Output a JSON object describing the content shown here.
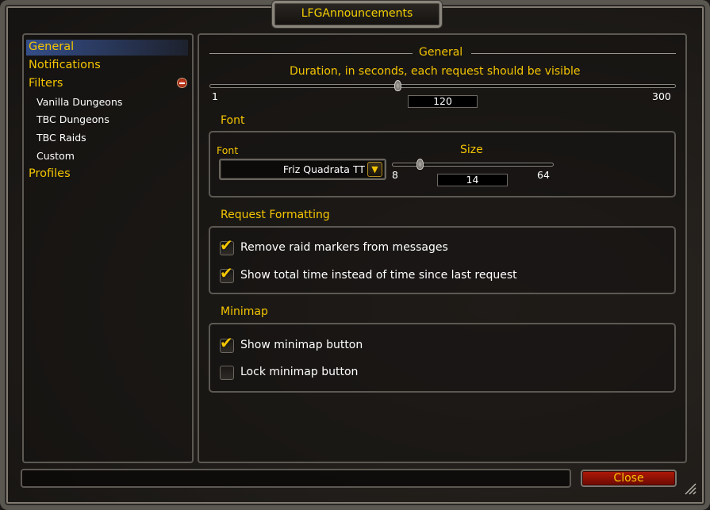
{
  "window": {
    "title": "LFGAnnouncements"
  },
  "sidebar": {
    "items": [
      {
        "label": "General",
        "selected": true
      },
      {
        "label": "Notifications"
      },
      {
        "label": "Filters",
        "expanded": true
      },
      {
        "label": "Vanilla Dungeons"
      },
      {
        "label": "TBC Dungeons"
      },
      {
        "label": "TBC Raids"
      },
      {
        "label": "Custom"
      },
      {
        "label": "Profiles"
      }
    ]
  },
  "general": {
    "header": "General",
    "duration": {
      "label": "Duration, in seconds, each request should be visible",
      "min": "1",
      "max": "300",
      "value": "120"
    }
  },
  "font": {
    "header": "Font",
    "font_label": "Font",
    "font_value": "Friz Quadrata TT",
    "size_label": "Size",
    "size_min": "8",
    "size_max": "64",
    "size_value": "14"
  },
  "formatting": {
    "header": "Request Formatting",
    "options": [
      {
        "label": "Remove raid markers from messages",
        "checked": true
      },
      {
        "label": "Show total time instead of time since last request",
        "checked": true
      }
    ]
  },
  "minimap": {
    "header": "Minimap",
    "options": [
      {
        "label": "Show minimap button",
        "checked": true
      },
      {
        "label": "Lock minimap button",
        "checked": false
      }
    ]
  },
  "footer": {
    "close_label": "Close"
  },
  "colors": {
    "gold": "#f4c500",
    "close_red": "#b01808"
  }
}
